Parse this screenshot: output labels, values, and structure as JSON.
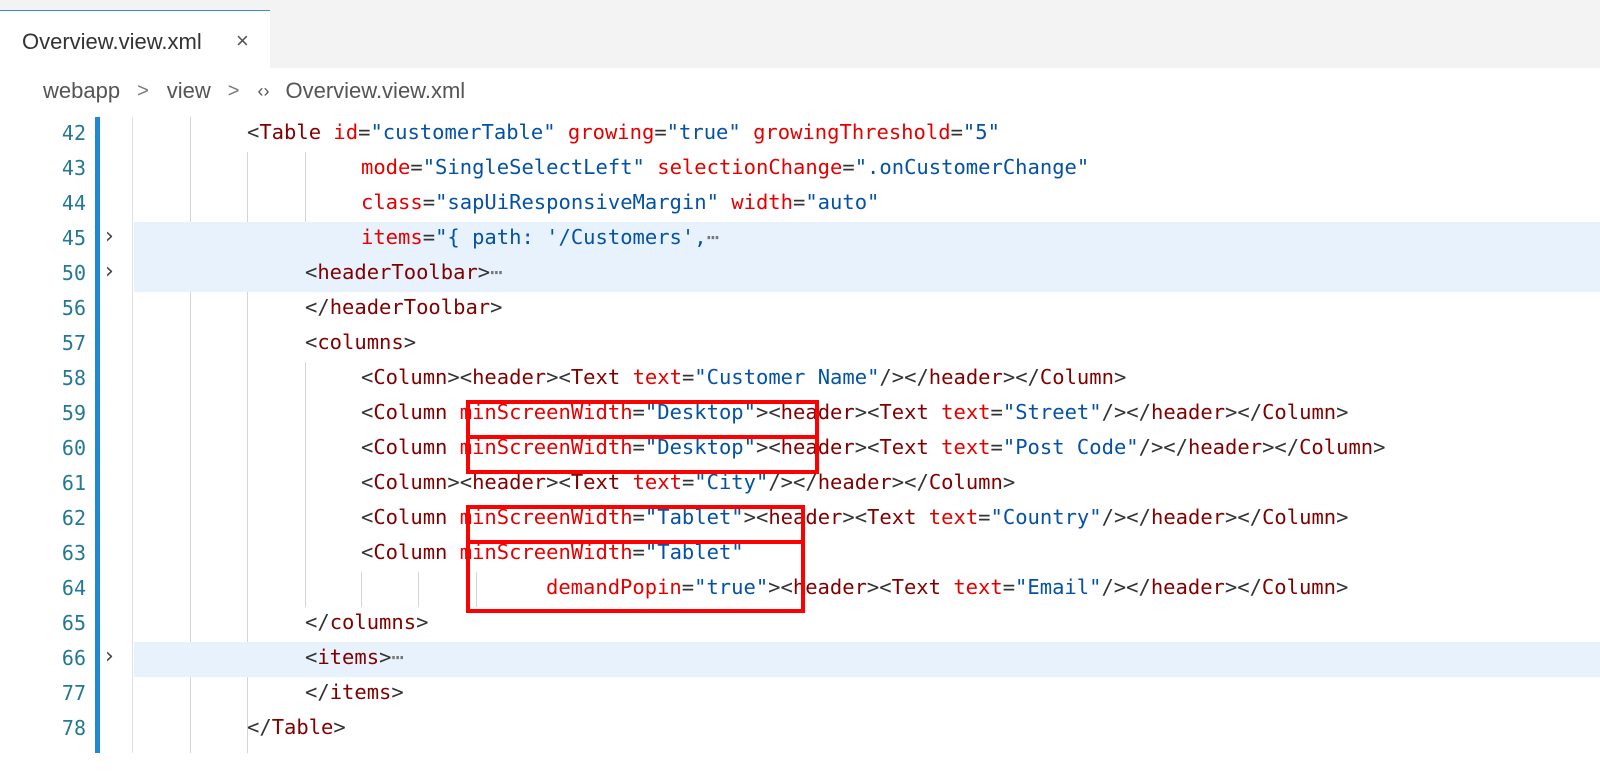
{
  "tab": {
    "label": "Overview.view.xml",
    "close": "×"
  },
  "breadcrumb": {
    "items": [
      "webapp",
      "view",
      "Overview.view.xml"
    ],
    "separator": ">",
    "file_icon": "‹›"
  },
  "colors": {
    "tag": "#800000",
    "attribute": "#e50000",
    "value": "#0451a5",
    "highlight_box": "#ff0000",
    "line_number": "#237893"
  },
  "editor": {
    "lines": [
      {
        "num": "42",
        "fold": false,
        "tokens": [
          [
            "p",
            "<"
          ],
          [
            "t",
            "Table"
          ],
          [
            "p",
            " "
          ],
          [
            "a",
            "id"
          ],
          [
            "p",
            "="
          ],
          [
            "v",
            "\"customerTable\""
          ],
          [
            "p",
            " "
          ],
          [
            "a",
            "growing"
          ],
          [
            "p",
            "="
          ],
          [
            "v",
            "\"true\""
          ],
          [
            "p",
            " "
          ],
          [
            "a",
            "growingThreshold"
          ],
          [
            "p",
            "="
          ],
          [
            "v",
            "\"5\""
          ]
        ]
      },
      {
        "num": "43",
        "fold": false,
        "tokens": [
          [
            "a",
            "mode"
          ],
          [
            "p",
            "="
          ],
          [
            "v",
            "\"SingleSelectLeft\""
          ],
          [
            "p",
            " "
          ],
          [
            "a",
            "selectionChange"
          ],
          [
            "p",
            "="
          ],
          [
            "v",
            "\".onCustomerChange\""
          ]
        ]
      },
      {
        "num": "44",
        "fold": false,
        "tokens": [
          [
            "a",
            "class"
          ],
          [
            "p",
            "="
          ],
          [
            "v",
            "\"sapUiResponsiveMargin\""
          ],
          [
            "p",
            " "
          ],
          [
            "a",
            "width"
          ],
          [
            "p",
            "="
          ],
          [
            "v",
            "\"auto\""
          ]
        ]
      },
      {
        "num": "45",
        "fold": true,
        "tokens": [
          [
            "a",
            "items"
          ],
          [
            "p",
            "="
          ],
          [
            "v",
            "\"{ path: '/Customers',"
          ],
          [
            "ell",
            "⋯"
          ]
        ]
      },
      {
        "num": "50",
        "fold": true,
        "tokens": [
          [
            "p",
            "<"
          ],
          [
            "t",
            "headerToolbar"
          ],
          [
            "p",
            ">"
          ],
          [
            "ell",
            "⋯"
          ]
        ]
      },
      {
        "num": "56",
        "fold": false,
        "tokens": [
          [
            "p",
            "</"
          ],
          [
            "t",
            "headerToolbar"
          ],
          [
            "p",
            ">"
          ]
        ]
      },
      {
        "num": "57",
        "fold": false,
        "tokens": [
          [
            "p",
            "<"
          ],
          [
            "t",
            "columns"
          ],
          [
            "p",
            ">"
          ]
        ]
      },
      {
        "num": "58",
        "fold": false,
        "tokens": [
          [
            "p",
            "<"
          ],
          [
            "t",
            "Column"
          ],
          [
            "p",
            "><"
          ],
          [
            "t",
            "header"
          ],
          [
            "p",
            "><"
          ],
          [
            "t",
            "Text"
          ],
          [
            "p",
            " "
          ],
          [
            "a",
            "text"
          ],
          [
            "p",
            "="
          ],
          [
            "v",
            "\"Customer Name\""
          ],
          [
            "p",
            "/></"
          ],
          [
            "t",
            "header"
          ],
          [
            "p",
            "></"
          ],
          [
            "t",
            "Column"
          ],
          [
            "p",
            ">"
          ]
        ]
      },
      {
        "num": "59",
        "fold": false,
        "tokens": [
          [
            "p",
            "<"
          ],
          [
            "t",
            "Column"
          ],
          [
            "p",
            " "
          ],
          [
            "a",
            "minScreenWidth"
          ],
          [
            "p",
            "="
          ],
          [
            "v",
            "\"Desktop\""
          ],
          [
            "p",
            "><"
          ],
          [
            "t",
            "header"
          ],
          [
            "p",
            "><"
          ],
          [
            "t",
            "Text"
          ],
          [
            "p",
            " "
          ],
          [
            "a",
            "text"
          ],
          [
            "p",
            "="
          ],
          [
            "v",
            "\"Street\""
          ],
          [
            "p",
            "/></"
          ],
          [
            "t",
            "header"
          ],
          [
            "p",
            "></"
          ],
          [
            "t",
            "Column"
          ],
          [
            "p",
            ">"
          ]
        ]
      },
      {
        "num": "60",
        "fold": false,
        "tokens": [
          [
            "p",
            "<"
          ],
          [
            "t",
            "Column"
          ],
          [
            "p",
            " "
          ],
          [
            "a",
            "minScreenWidth"
          ],
          [
            "p",
            "="
          ],
          [
            "v",
            "\"Desktop\""
          ],
          [
            "p",
            "><"
          ],
          [
            "t",
            "header"
          ],
          [
            "p",
            "><"
          ],
          [
            "t",
            "Text"
          ],
          [
            "p",
            " "
          ],
          [
            "a",
            "text"
          ],
          [
            "p",
            "="
          ],
          [
            "v",
            "\"Post Code\""
          ],
          [
            "p",
            "/></"
          ],
          [
            "t",
            "header"
          ],
          [
            "p",
            "></"
          ],
          [
            "t",
            "Column"
          ],
          [
            "p",
            ">"
          ]
        ]
      },
      {
        "num": "61",
        "fold": false,
        "tokens": [
          [
            "p",
            "<"
          ],
          [
            "t",
            "Column"
          ],
          [
            "p",
            "><"
          ],
          [
            "t",
            "header"
          ],
          [
            "p",
            "><"
          ],
          [
            "t",
            "Text"
          ],
          [
            "p",
            " "
          ],
          [
            "a",
            "text"
          ],
          [
            "p",
            "="
          ],
          [
            "v",
            "\"City\""
          ],
          [
            "p",
            "/></"
          ],
          [
            "t",
            "header"
          ],
          [
            "p",
            "></"
          ],
          [
            "t",
            "Column"
          ],
          [
            "p",
            ">"
          ]
        ]
      },
      {
        "num": "62",
        "fold": false,
        "tokens": [
          [
            "p",
            "<"
          ],
          [
            "t",
            "Column"
          ],
          [
            "p",
            " "
          ],
          [
            "a",
            "minScreenWidth"
          ],
          [
            "p",
            "="
          ],
          [
            "v",
            "\"Tablet\""
          ],
          [
            "p",
            "><"
          ],
          [
            "t",
            "header"
          ],
          [
            "p",
            "><"
          ],
          [
            "t",
            "Text"
          ],
          [
            "p",
            " "
          ],
          [
            "a",
            "text"
          ],
          [
            "p",
            "="
          ],
          [
            "v",
            "\"Country\""
          ],
          [
            "p",
            "/></"
          ],
          [
            "t",
            "header"
          ],
          [
            "p",
            "></"
          ],
          [
            "t",
            "Column"
          ],
          [
            "p",
            ">"
          ]
        ]
      },
      {
        "num": "63",
        "fold": false,
        "tokens": [
          [
            "p",
            "<"
          ],
          [
            "t",
            "Column"
          ],
          [
            "p",
            " "
          ],
          [
            "a",
            "minScreenWidth"
          ],
          [
            "p",
            "="
          ],
          [
            "v",
            "\"Tablet\""
          ]
        ]
      },
      {
        "num": "64",
        "fold": false,
        "tokens": [
          [
            "a",
            "demandPopin"
          ],
          [
            "p",
            "="
          ],
          [
            "v",
            "\"true\""
          ],
          [
            "p",
            "><"
          ],
          [
            "t",
            "header"
          ],
          [
            "p",
            "><"
          ],
          [
            "t",
            "Text"
          ],
          [
            "p",
            " "
          ],
          [
            "a",
            "text"
          ],
          [
            "p",
            "="
          ],
          [
            "v",
            "\"Email\""
          ],
          [
            "p",
            "/></"
          ],
          [
            "t",
            "header"
          ],
          [
            "p",
            "></"
          ],
          [
            "t",
            "Column"
          ],
          [
            "p",
            ">"
          ]
        ]
      },
      {
        "num": "65",
        "fold": false,
        "tokens": [
          [
            "p",
            "</"
          ],
          [
            "t",
            "columns"
          ],
          [
            "p",
            ">"
          ]
        ]
      },
      {
        "num": "66",
        "fold": true,
        "tokens": [
          [
            "p",
            "<"
          ],
          [
            "t",
            "items"
          ],
          [
            "p",
            ">"
          ],
          [
            "ell",
            "⋯"
          ]
        ]
      },
      {
        "num": "77",
        "fold": false,
        "tokens": [
          [
            "p",
            "</"
          ],
          [
            "t",
            "items"
          ],
          [
            "p",
            ">"
          ]
        ]
      },
      {
        "num": "78",
        "fold": false,
        "tokens": [
          [
            "p",
            "</"
          ],
          [
            "t",
            "Table"
          ],
          [
            "p",
            ">"
          ]
        ]
      }
    ],
    "fold_icon": "›"
  }
}
